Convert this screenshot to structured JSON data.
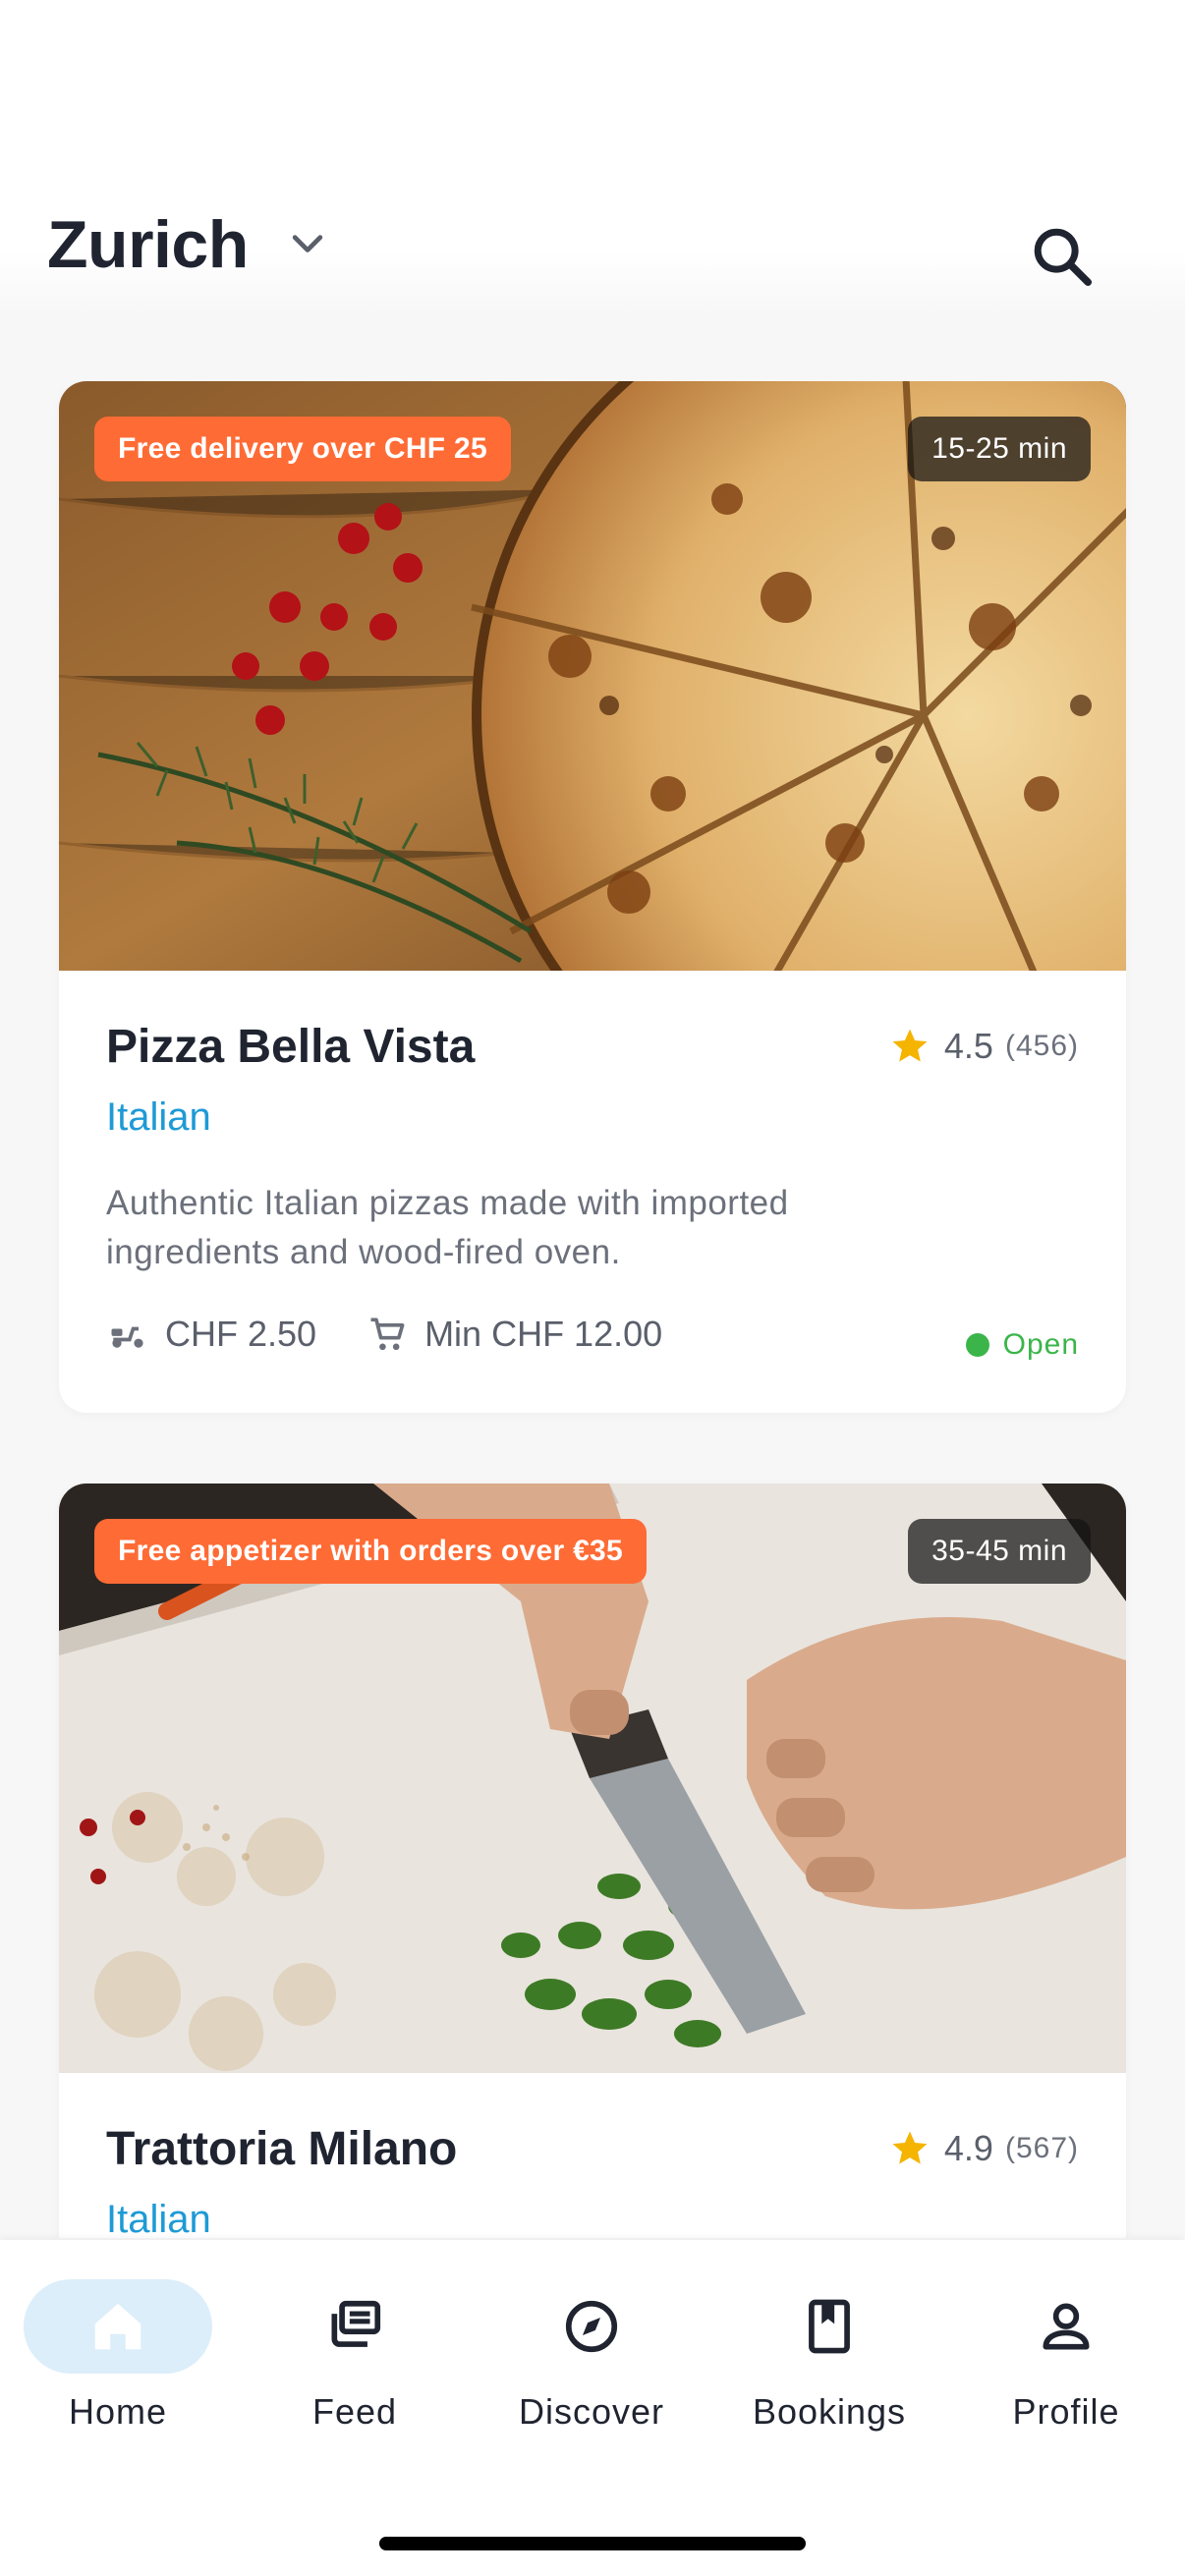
{
  "header": {
    "city": "Zurich",
    "chevron_icon": "chevron-down-icon",
    "search_icon": "search-icon"
  },
  "restaurants": [
    {
      "promo": "Free delivery over CHF 25",
      "eta": "15-25 min",
      "name": "Pizza Bella Vista",
      "cuisine": "Italian",
      "rating": "4.5",
      "reviews": "(456)",
      "description": "Authentic Italian pizzas made with imported ingredients and wood-fired oven.",
      "delivery_fee": "CHF 2.50",
      "min_order": "Min CHF 12.00",
      "status": "Open"
    },
    {
      "promo": "Free appetizer with orders over €35",
      "eta": "35-45 min",
      "name": "Trattoria Milano",
      "cuisine": "Italian",
      "rating": "4.9",
      "reviews": "(567)"
    }
  ],
  "nav": {
    "items": [
      {
        "label": "Home",
        "icon": "home-icon",
        "active": true
      },
      {
        "label": "Feed",
        "icon": "feed-icon"
      },
      {
        "label": "Discover",
        "icon": "compass-icon"
      },
      {
        "label": "Bookings",
        "icon": "bookmark-icon"
      },
      {
        "label": "Profile",
        "icon": "person-icon"
      }
    ]
  },
  "colors": {
    "accent": "#ff6b35",
    "link": "#1e9ad6",
    "star": "#f5b400",
    "open": "#3bb54a",
    "nav_active_bg": "#dceefa"
  }
}
